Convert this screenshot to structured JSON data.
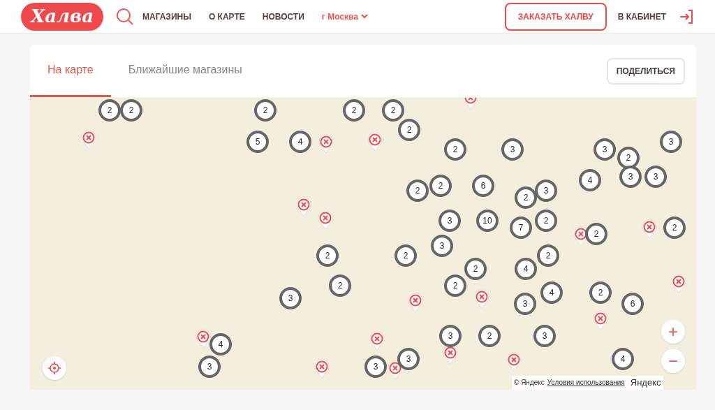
{
  "header": {
    "logo": "Халва",
    "nav": [
      {
        "label": "МАГАЗИНЫ"
      },
      {
        "label": "О КАРТЕ"
      },
      {
        "label": "НОВОСТИ"
      }
    ],
    "city": "г Москва",
    "order_button": "ЗАКАЗАТЬ ХАЛВУ",
    "cabinet": "В КАБИНЕТ"
  },
  "tabs": [
    {
      "label": "На карте",
      "selected": true
    },
    {
      "label": "Ближайшие магазины",
      "selected": false
    }
  ],
  "share_button": "ПОДЕЛИТЬСЯ",
  "map": {
    "clusters": [
      "2",
      "2",
      "2",
      "2",
      "2",
      "2",
      "5",
      "4",
      "3",
      "2",
      "3",
      "3",
      "2",
      "4",
      "3",
      "3",
      "2",
      "6",
      "2",
      "3",
      "2",
      "3",
      "10",
      "2",
      "7",
      "2",
      "2",
      "3",
      "2",
      "2",
      "2",
      "2",
      "4",
      "2",
      "2",
      "4",
      "2",
      "3",
      "3",
      "6",
      "3",
      "2",
      "3",
      "4",
      "3",
      "4",
      "3",
      "3"
    ],
    "zoom_in": "+",
    "zoom_out": "−",
    "copyright": "© Яндекс",
    "terms_link": "Условия использования",
    "provider_logo": "Яндекс"
  }
}
